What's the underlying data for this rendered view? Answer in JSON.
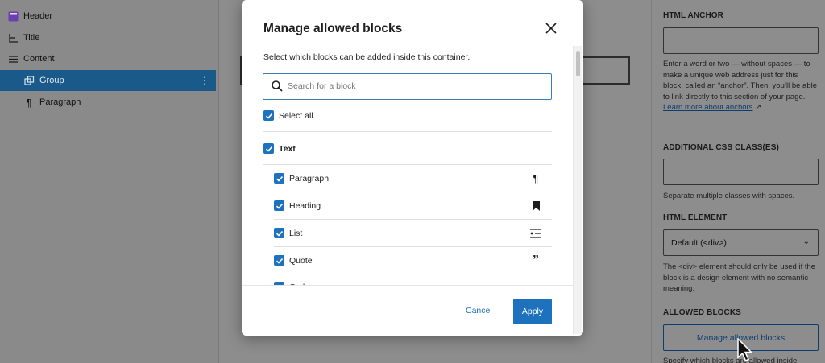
{
  "list_view": {
    "items": [
      {
        "label": "Header",
        "icon": "header-template-icon"
      },
      {
        "label": "Title",
        "icon": "title-icon"
      },
      {
        "label": "Content",
        "icon": "content-icon"
      },
      {
        "label": "Group",
        "icon": "group-icon",
        "selected": true
      },
      {
        "label": "Paragraph",
        "icon": "paragraph-icon"
      }
    ]
  },
  "modal": {
    "title": "Manage allowed blocks",
    "description": "Select which blocks can be added inside this container.",
    "search_placeholder": "Search for a block",
    "select_all": "Select all",
    "category": "Text",
    "blocks": [
      {
        "label": "Paragraph",
        "icon": "paragraph-icon"
      },
      {
        "label": "Heading",
        "icon": "bookmark-icon"
      },
      {
        "label": "List",
        "icon": "list-icon"
      },
      {
        "label": "Quote",
        "icon": "quote-icon"
      },
      {
        "label": "Code",
        "icon": "code-icon"
      }
    ],
    "cancel": "Cancel",
    "apply": "Apply",
    "accent": "#1e72bd"
  },
  "sidebar": {
    "html_anchor": "HTML ANCHOR",
    "anchor_help": "Enter a word or two — without spaces — to make a unique web address just for this block, called an “anchor”. Then, you’ll be able to link directly to this section of your page.",
    "anchor_link": "Learn more about anchors",
    "css_class": "ADDITIONAL CSS CLASS(ES)",
    "css_help": "Separate multiple classes with spaces.",
    "html_element": "HTML ELEMENT",
    "html_element_value": "Default (<div>)",
    "html_element_help": "The <div> element should only be used if the block is a design element with no semantic meaning.",
    "allowed_blocks": "ALLOWED BLOCKS",
    "manage_button": "Manage allowed blocks",
    "allowed_help": "Specify which blocks are allowed inside"
  }
}
